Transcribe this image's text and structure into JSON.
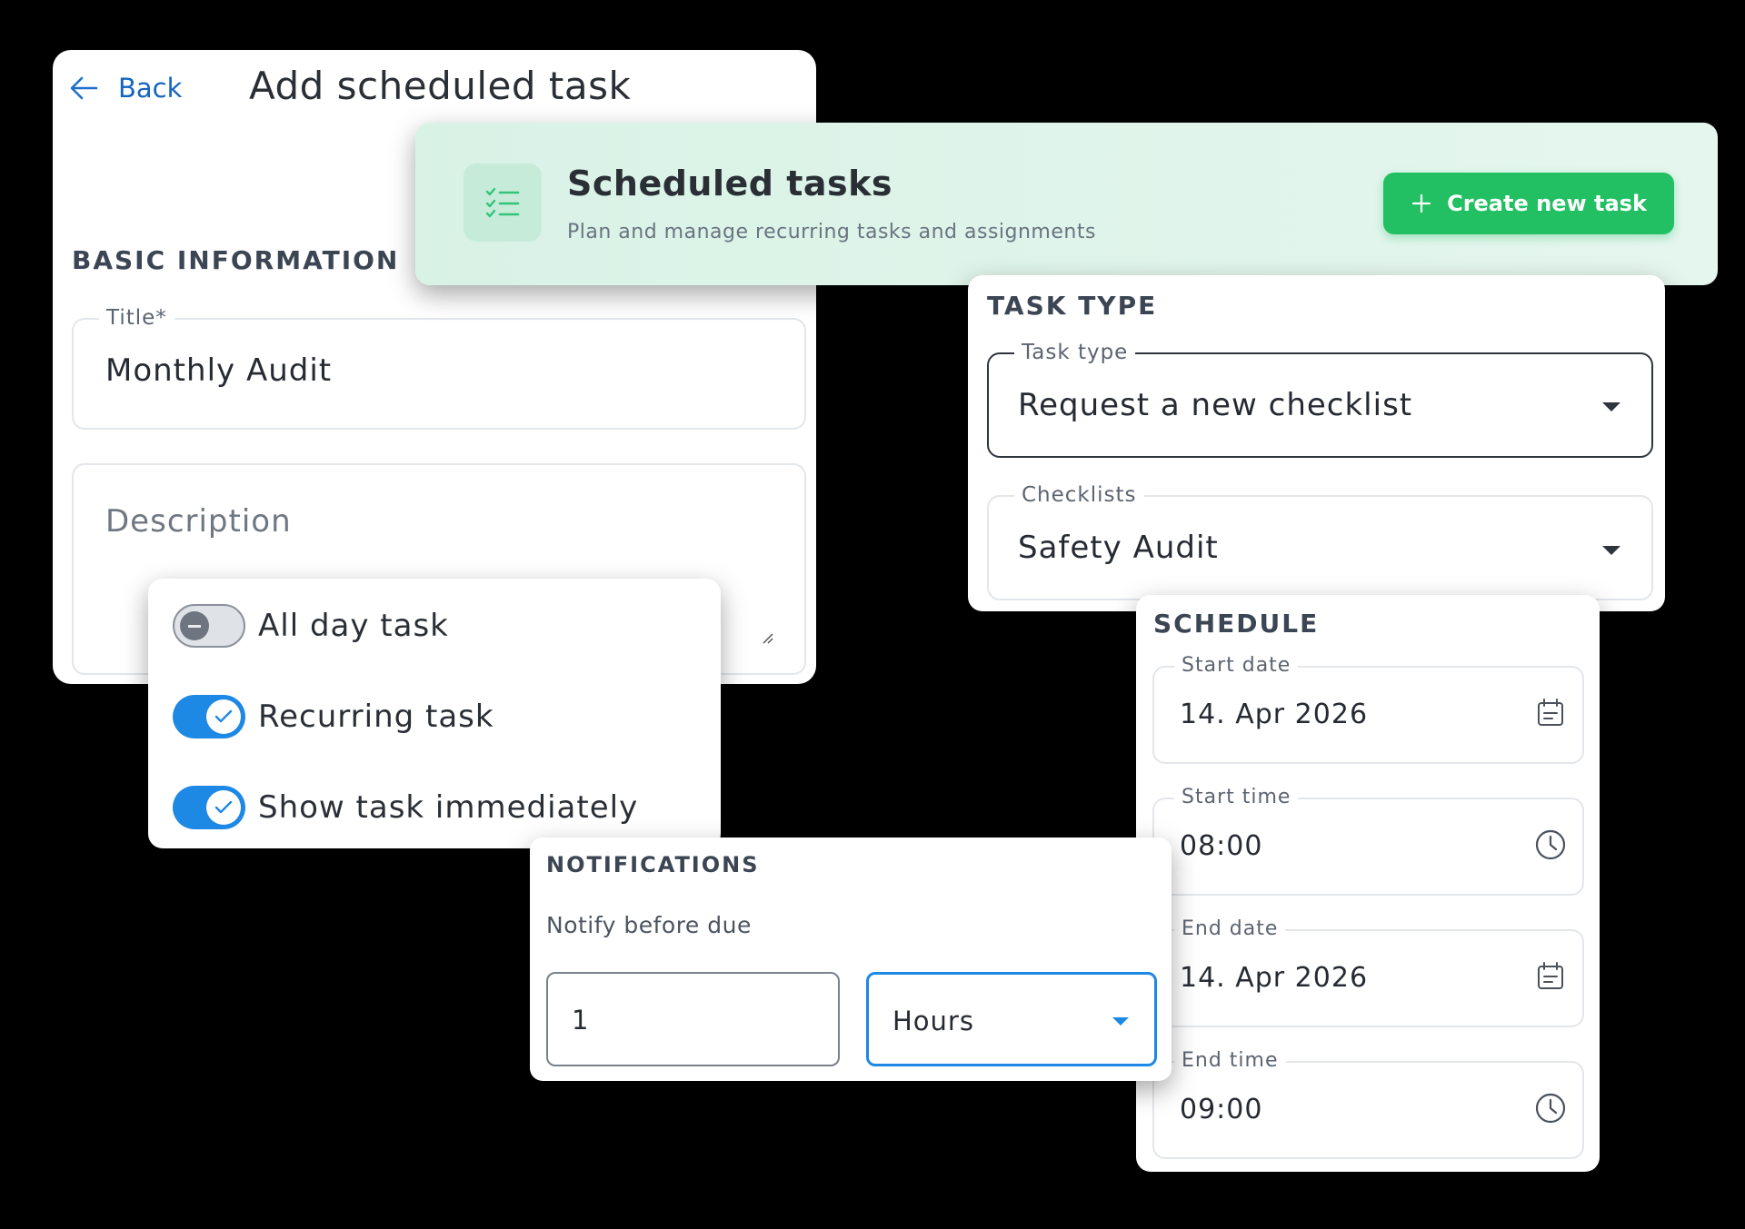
{
  "add_task": {
    "back_label": "Back",
    "title": "Add scheduled task",
    "basic_section": "BASIC INFORMATION",
    "title_field": {
      "label": "Title*",
      "value": "Monthly Audit"
    },
    "description_field": {
      "placeholder": "Description"
    }
  },
  "toggles": [
    {
      "label": "All day task",
      "on": false
    },
    {
      "label": "Recurring task",
      "on": true
    },
    {
      "label": "Show task immediately",
      "on": true
    }
  ],
  "header": {
    "title": "Scheduled tasks",
    "subtitle": "Plan and manage recurring tasks and assignments",
    "create_button": "Create new task",
    "icon": "checklist-icon",
    "accent": "#22c063"
  },
  "task_type": {
    "section": "TASK TYPE",
    "type_field": {
      "label": "Task type",
      "value": "Request a new checklist"
    },
    "checklists_field": {
      "label": "Checklists",
      "value": "Safety Audit"
    }
  },
  "schedule": {
    "section": "SCHEDULE",
    "start_date": {
      "label": "Start date",
      "value": "14. Apr 2026",
      "icon": "calendar-icon"
    },
    "start_time": {
      "label": "Start time",
      "value": "08:00",
      "icon": "clock-icon"
    },
    "end_date": {
      "label": "End date",
      "value": "14. Apr 2026",
      "icon": "calendar-icon"
    },
    "end_time": {
      "label": "End time",
      "value": "09:00",
      "icon": "clock-icon"
    }
  },
  "notifications": {
    "section": "NOTIFICATIONS",
    "label": "Notify before due",
    "amount": "1",
    "unit": "Hours",
    "focus_color": "#1e88e5"
  }
}
